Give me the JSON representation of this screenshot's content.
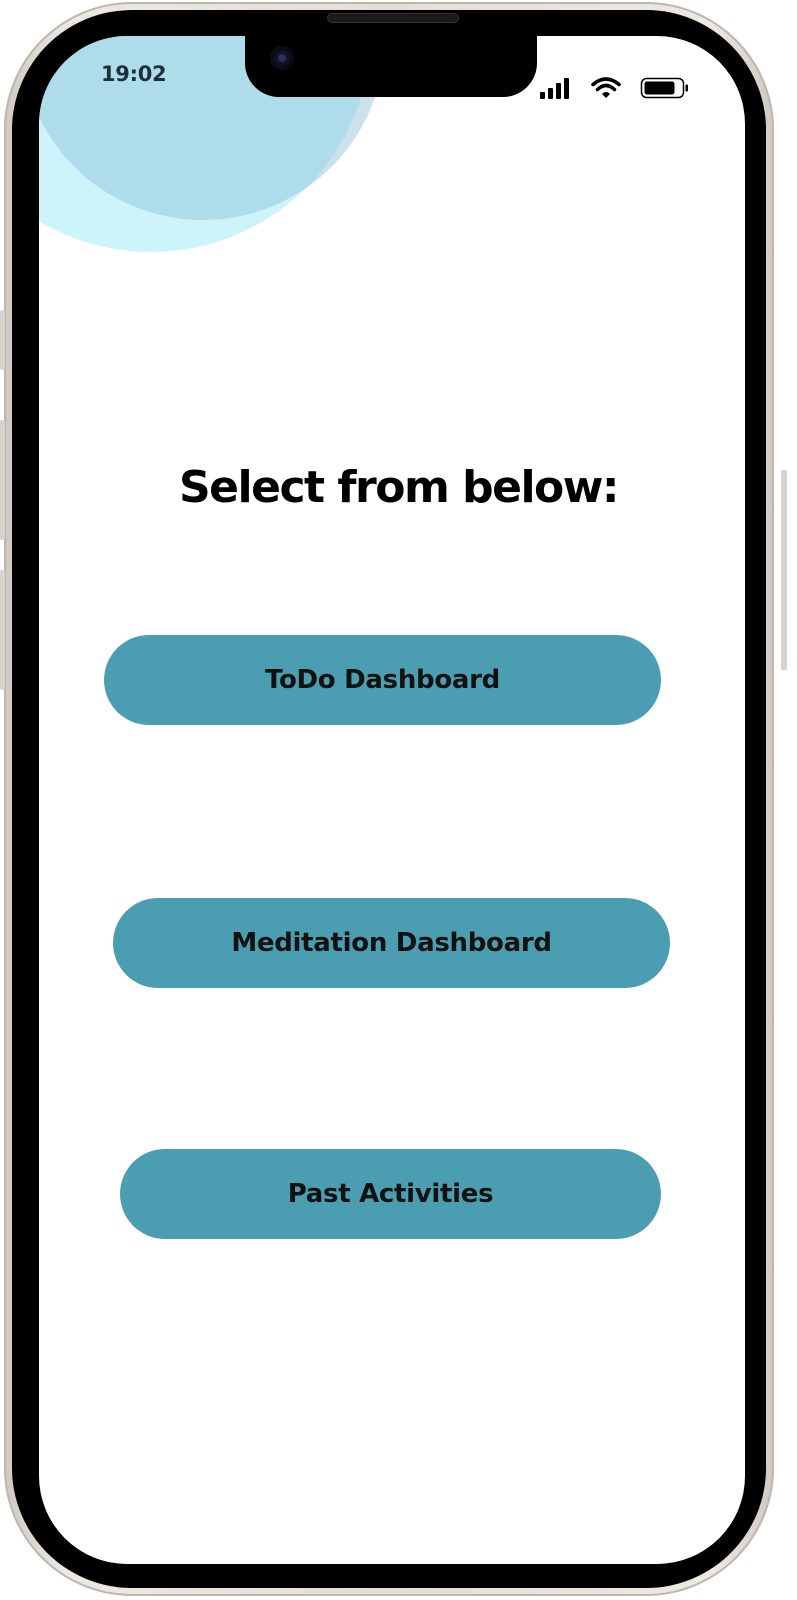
{
  "status_bar": {
    "time": "19:02",
    "icons": [
      "cellular-signal-icon",
      "wifi-icon",
      "battery-icon"
    ]
  },
  "main": {
    "heading": "Select from below:",
    "buttons": [
      {
        "label": "ToDo Dashboard"
      },
      {
        "label": "Meditation Dashboard"
      },
      {
        "label": "Past Activities"
      }
    ]
  },
  "colors": {
    "button": "#4b9eb1",
    "blob_light": "#c8f2fa",
    "blob_dark": "#9fcbdc"
  }
}
